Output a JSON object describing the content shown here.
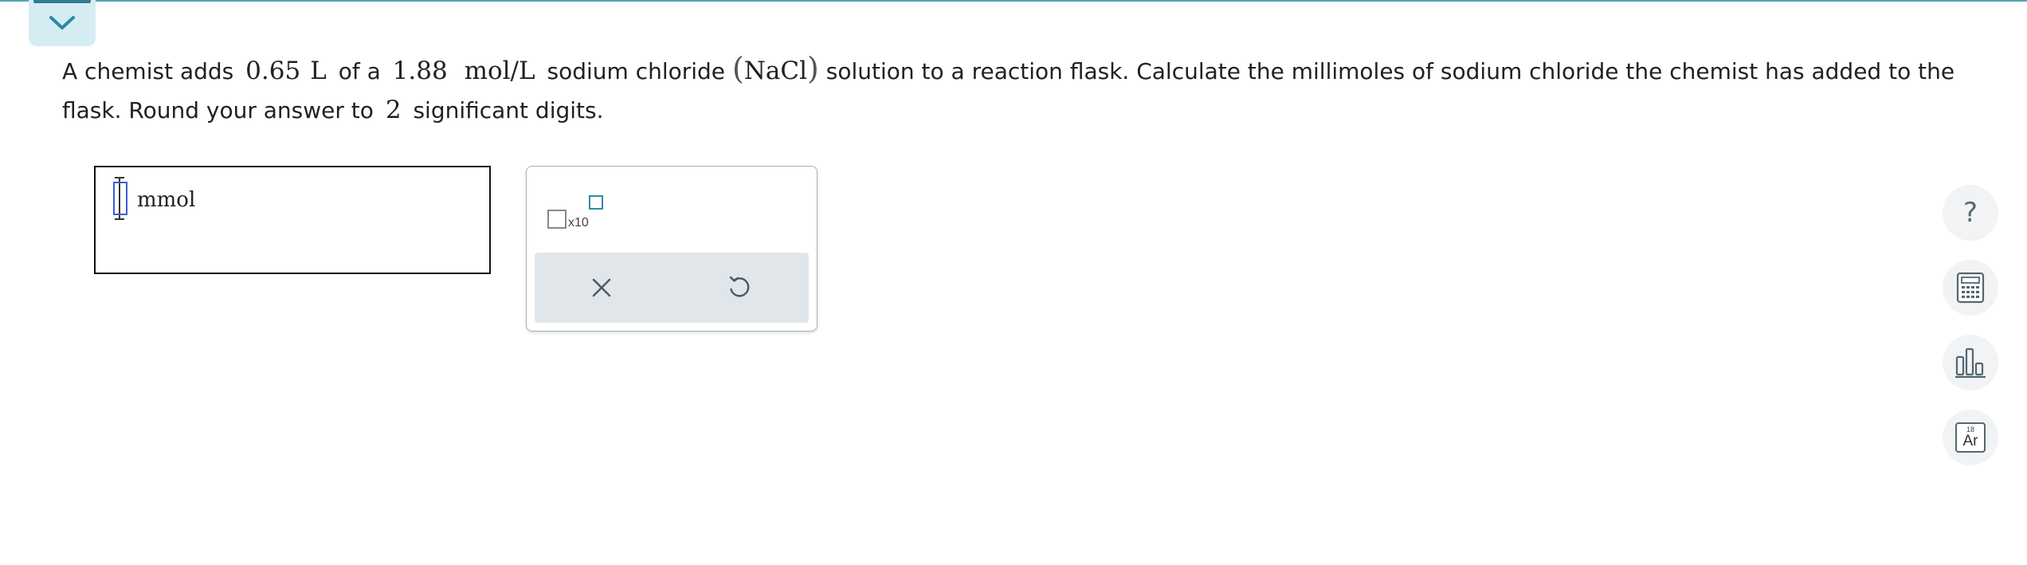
{
  "question": {
    "t1": "A chemist adds",
    "volume": "0.65",
    "volume_unit": "L",
    "t2": "of a",
    "concentration": "1.88",
    "concentration_unit": "mol/L",
    "t3": "sodium chloride",
    "formula": "NaCl",
    "t4": "solution to a reaction flask. Calculate the millimoles of sodium chloride the chemist has added to the flask. Round your answer to",
    "sig_figs": "2",
    "t5": "significant digits."
  },
  "answer": {
    "value": "",
    "unit": "mmol"
  },
  "palette": {
    "sci_notation_label": "x10",
    "clear_icon": "close-icon",
    "undo_icon": "undo-icon"
  },
  "side_tools": [
    {
      "icon": "help-icon",
      "glyph": "?"
    },
    {
      "icon": "calculator-icon"
    },
    {
      "icon": "bar-chart-icon"
    },
    {
      "icon": "periodic-table-icon",
      "number": "18",
      "symbol": "Ar"
    }
  ],
  "colors": {
    "accent": "#2e8aa8",
    "tab_bg": "#d6ecf3",
    "action_bar_bg": "#e1e6ea",
    "cursor": "#3d5dd6"
  }
}
